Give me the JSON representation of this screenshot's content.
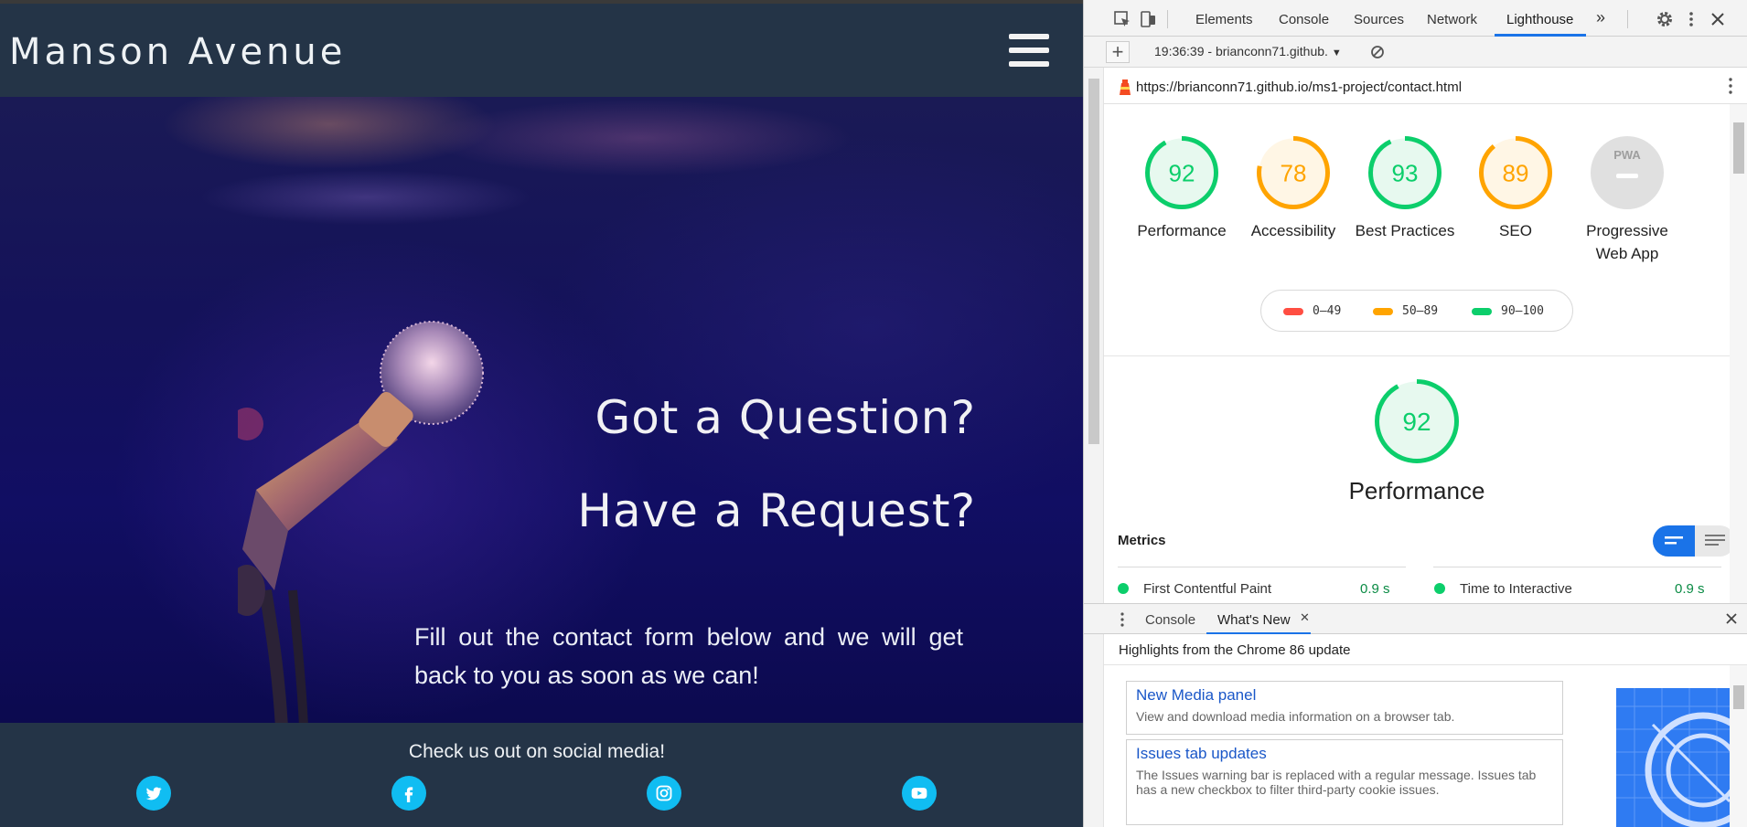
{
  "site": {
    "brand": "Manson Avenue",
    "hero": {
      "heading1": "Got a Question?",
      "heading2": "Have a Request?",
      "paragraph": "Fill out the contact form below and we will get back to you as soon as we can!"
    },
    "footer": {
      "social_title": "Check us out on social media!",
      "icons": [
        "twitter-icon",
        "facebook-icon",
        "instagram-icon",
        "youtube-icon"
      ]
    },
    "colors": {
      "header_bg": "#243447",
      "social_accent": "#10bdf2"
    }
  },
  "devtools": {
    "tabs": [
      "Elements",
      "Console",
      "Sources",
      "Network",
      "Lighthouse"
    ],
    "more_tabs": "»",
    "active_tab": "Lighthouse",
    "report_select": "19:36:39 - brianconn71.github.",
    "report_select_caret": "▼",
    "url": "https://brianconn71.github.io/ms1-project/contact.html",
    "categories": [
      {
        "label": "Performance",
        "score": "92",
        "status": "pass"
      },
      {
        "label": "Accessibility",
        "score": "78",
        "status": "average"
      },
      {
        "label": "Best Practices",
        "score": "93",
        "status": "pass"
      },
      {
        "label": "SEO",
        "score": "89",
        "status": "average"
      },
      {
        "label": "Progressive Web App",
        "score": "",
        "badge": "PWA",
        "status": "na"
      }
    ],
    "legend": [
      {
        "range": "0–49",
        "color": "#ff4e42"
      },
      {
        "range": "50–89",
        "color": "#ffa400"
      },
      {
        "range": "90–100",
        "color": "#0cce6b"
      }
    ],
    "performance": {
      "score": "92",
      "title": "Performance",
      "metrics_title": "Metrics",
      "metrics": [
        {
          "name": "First Contentful Paint",
          "value": "0.9 s"
        },
        {
          "name": "Time to Interactive",
          "value": "0.9 s"
        }
      ]
    },
    "drawer": {
      "tabs": [
        "Console",
        "What's New"
      ],
      "active_tab": "What's New",
      "tab_close": "✕",
      "highlights": "Highlights from the Chrome 86 update",
      "cards": [
        {
          "title": "New Media panel",
          "desc": "View and download media information on a browser tab."
        },
        {
          "title": "Issues tab updates",
          "desc": "The Issues warning bar is replaced with a regular message. Issues tab has a new checkbox to filter third-party cookie issues."
        }
      ]
    },
    "colors": {
      "pass": "#0cce6b",
      "average": "#ffa400",
      "fail": "#ff4e42",
      "accent": "#1a73e8"
    }
  }
}
